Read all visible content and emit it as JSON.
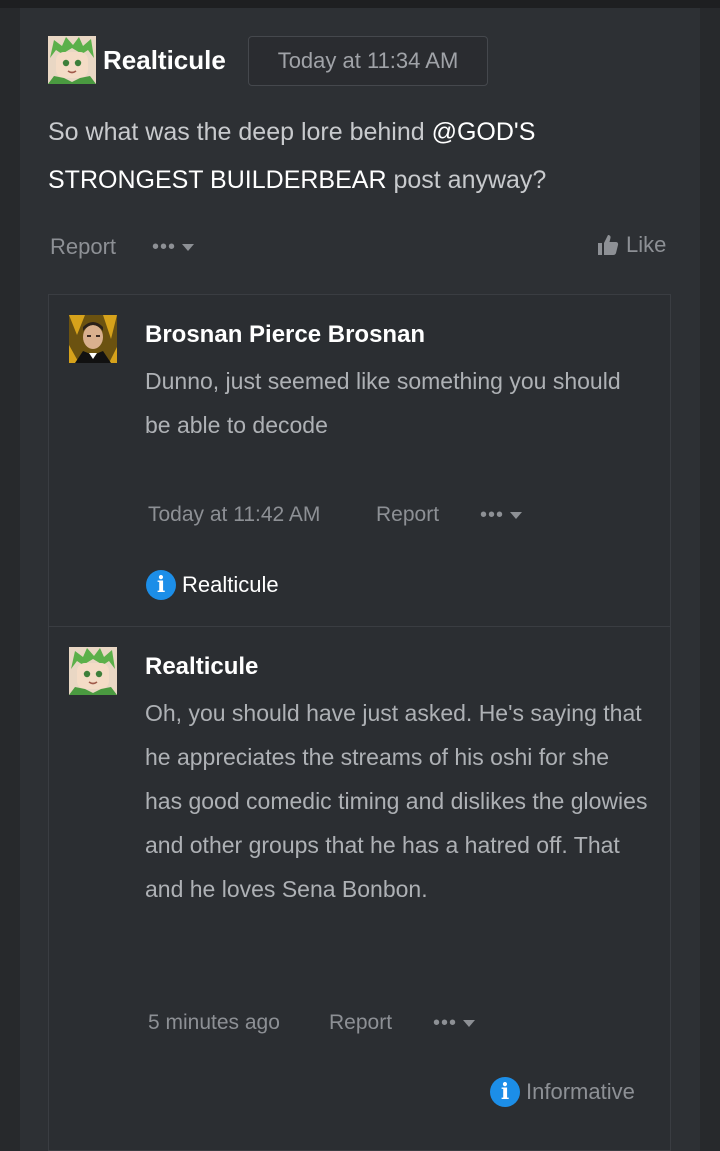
{
  "post": {
    "author": "Realticule",
    "timestamp": "Today at 11:34 AM",
    "body_before": "So what was the deep lore behind ",
    "mention": "@GOD'S STRONGEST BUILDERBEAR",
    "body_after": " post anyway?",
    "report_label": "Report",
    "more_label": "•••",
    "like_label": "Like"
  },
  "comments": [
    {
      "author": "Brosnan Pierce Brosnan",
      "body": "Dunno, just seemed like something you should be able to decode",
      "timestamp": "Today at 11:42 AM",
      "report_label": "Report",
      "more_label": "•••",
      "reaction_label": "Realticule"
    },
    {
      "author": "Realticule",
      "body": "Oh, you should have just asked. He's saying that he appreciates the streams of his oshi for she has good comedic timing and dislikes the glowies and other groups that he has a hatred off. That and he loves Sena Bonbon.",
      "timestamp": "5 minutes ago",
      "report_label": "Report",
      "more_label": "•••",
      "reaction_label": "Informative"
    }
  ],
  "icons": {
    "info": "i",
    "like": "thumbs-up-icon",
    "dropdown": "caret-down-icon"
  },
  "colors": {
    "background": "#27292c",
    "panel": "#2d3034",
    "accent_blue": "#1c8ee8",
    "muted_text": "#8d9095"
  }
}
